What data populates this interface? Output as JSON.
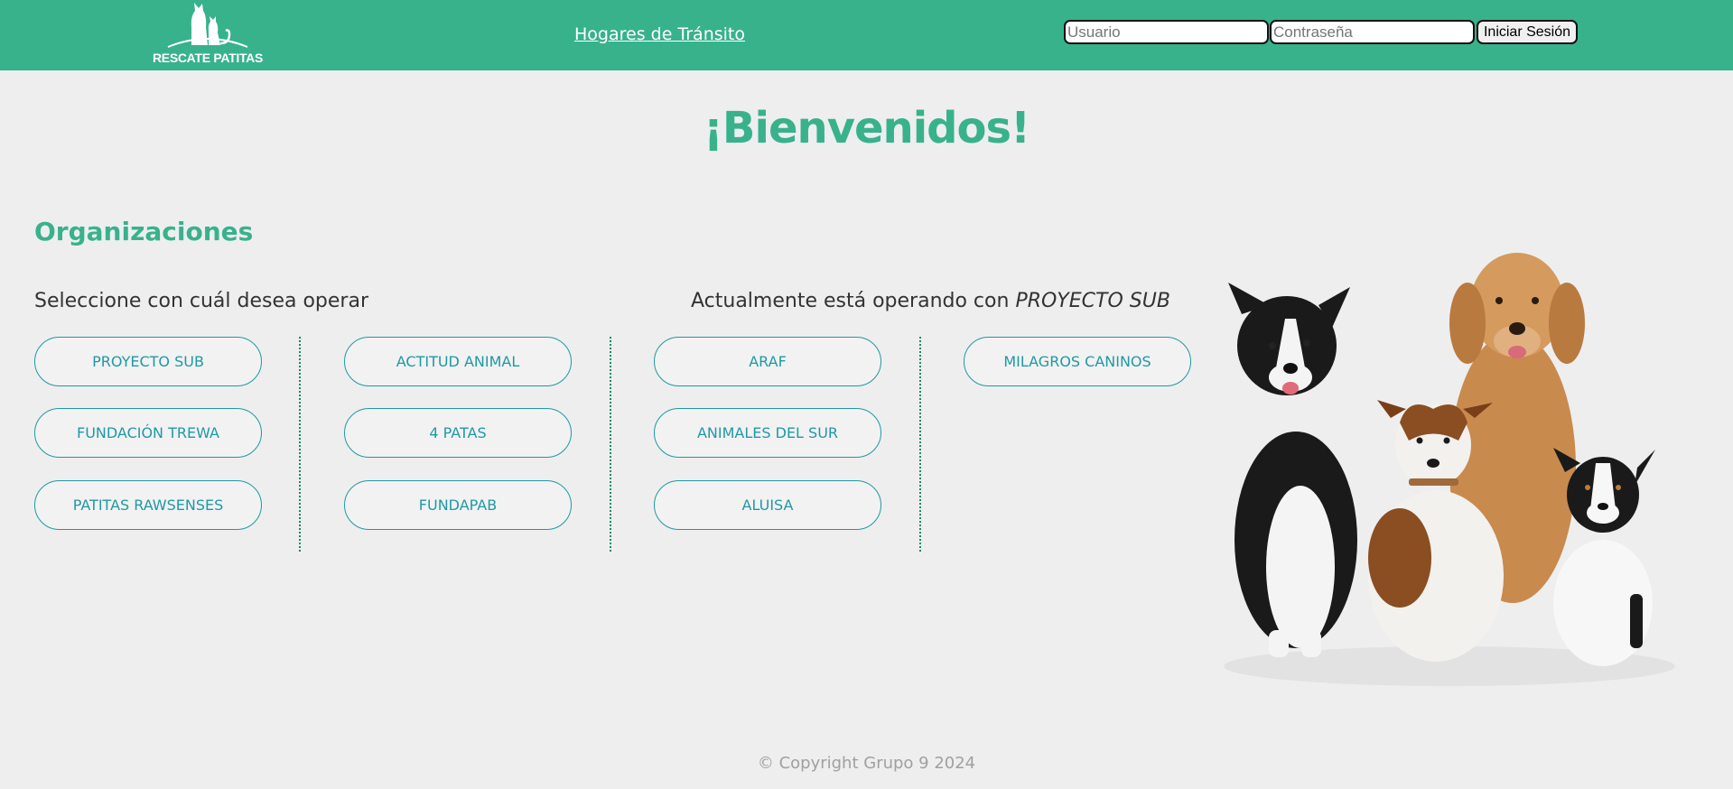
{
  "header": {
    "logo_text": "RESCATE PATITAS",
    "nav_link": "Hogares de Tránsito",
    "login": {
      "user_placeholder": "Usuario",
      "password_placeholder": "Contraseña",
      "submit_label": "Iniciar Sesión"
    }
  },
  "main": {
    "welcome": "¡Bienvenidos!",
    "section_title": "Organizaciones",
    "select_prompt": "Seleccione con cuál desea operar",
    "current_prefix": "Actualmente está operando con",
    "current_org": "PROYECTO SUB",
    "organizations": [
      "PROYECTO SUB",
      "FUNDACIÓN TREWA",
      "PATITAS RAWSENSES",
      "ACTITUD ANIMAL",
      "4 PATAS",
      "FUNDAPAB",
      "ARAF",
      "ANIMALES DEL SUR",
      "ALUISA",
      "MILAGROS CANINOS"
    ]
  },
  "footer": {
    "copyright": "© Copyright Grupo 9 2024"
  },
  "colors": {
    "header_bg": "#38b28b",
    "accent": "#38b28b",
    "button_border": "#1f99a6",
    "page_bg": "#eeeeee"
  }
}
